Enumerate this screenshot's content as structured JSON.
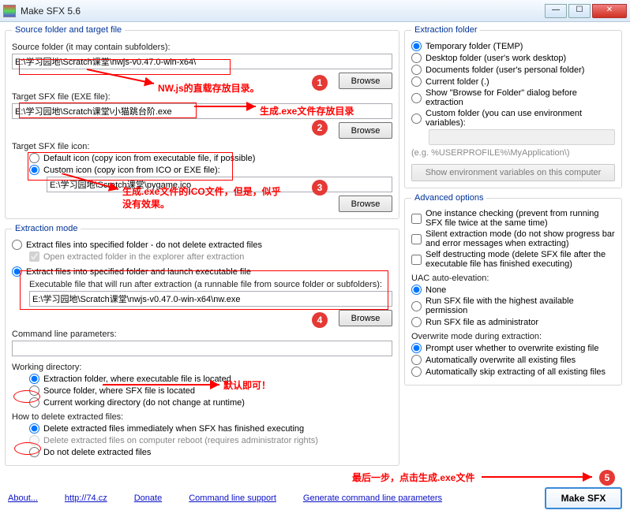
{
  "window": {
    "title": "Make SFX 5.6"
  },
  "source_target": {
    "legend": "Source folder and target file",
    "source_label": "Source folder (it may contain subfolders):",
    "source_value": "E:\\学习园地\\Scratch课堂\\nwjs-v0.47.0-win-x64\\",
    "target_label": "Target SFX file (EXE file):",
    "target_value": "E:\\学习园地\\Scratch课堂\\小猫跳台阶.exe",
    "icon_label": "Target SFX file icon:",
    "default_icon": "Default icon (copy icon from executable file, if possible)",
    "custom_icon": "Custom icon (copy icon from ICO or EXE file):",
    "icon_value": "E:\\学习园地\\Scratch课堂\\pygame.ico",
    "browse": "Browse"
  },
  "extraction_mode": {
    "legend": "Extraction mode",
    "opt1": "Extract files into specified folder - do not delete extracted files",
    "open_after": "Open extracted folder in the explorer after extraction",
    "opt2": "Extract files into specified folder and launch executable file",
    "exe_label": "Executable file that will run after extraction (a runnable file from source folder or subfolders):",
    "exe_value": "E:\\学习园地\\Scratch课堂\\nwjs-v0.47.0-win-x64\\nw.exe",
    "cmd_label": "Command line parameters:",
    "cmd_value": "",
    "wd_label": "Working directory:",
    "wd1": "Extraction folder, where executable file is located",
    "wd2": "Source folder, where SFX file is located",
    "wd3": "Current working directory (do not change at runtime)",
    "del_label": "How to delete extracted files:",
    "del1": "Delete extracted files immediately when SFX has finished executing",
    "del2": "Delete extracted files on computer reboot (requires administrator rights)",
    "del3": "Do not delete extracted files",
    "browse": "Browse"
  },
  "extraction_folder": {
    "legend": "Extraction folder",
    "r1": "Temporary folder (TEMP)",
    "r2": "Desktop folder (user's work desktop)",
    "r3": "Documents folder (user's personal folder)",
    "r4": "Current folder (.)",
    "r5": "Show \"Browse for Folder\" dialog before extraction",
    "r6": "Custom folder (you can use environment variables):",
    "hint": "(e.g. %USERPROFILE%\\MyApplication\\)",
    "env_btn": "Show environment variables on this computer"
  },
  "advanced": {
    "legend": "Advanced options",
    "c1": "One instance checking (prevent from running SFX file twice at the same time)",
    "c2": "Silent extraction mode (do not show progress bar and error messages when extracting)",
    "c3": "Self destructing mode (delete SFX file after the executable file has finished executing)",
    "uac_label": "UAC auto-elevation:",
    "u1": "None",
    "u2": "Run SFX file with the highest available permission",
    "u3": "Run SFX file as administrator",
    "ow_label": "Overwrite mode during extraction:",
    "o1": "Prompt user whether to overwrite existing file",
    "o2": "Automatically overwrite all existing files",
    "o3": "Automatically skip extracting of all existing files"
  },
  "footer": {
    "about": "About...",
    "site": "http://74.cz",
    "donate": "Donate",
    "cls": "Command line support",
    "gen": "Generate command line parameters",
    "make": "Make SFX"
  },
  "annotations": {
    "a1": "NW.js的直载存放目录。",
    "a2": "生成.exe文件存放目录",
    "a3a": "生成.exe文件的ICO文件，但是，似乎",
    "a3b": "没有效果。",
    "a4": "默认即可！",
    "a5": "最后一步，点击生成.exe文件",
    "b1": "1",
    "b2": "2",
    "b3": "3",
    "b4": "4",
    "b5": "5"
  }
}
